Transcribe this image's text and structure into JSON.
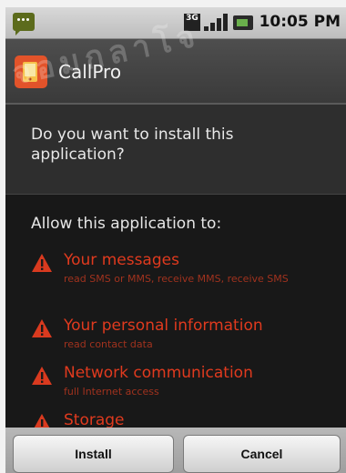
{
  "status_bar": {
    "network_type": "3G",
    "time": "10:05 PM",
    "icons": [
      "notification-icon",
      "3g-icon",
      "signal-icon",
      "battery-icon"
    ]
  },
  "dialog": {
    "app_name": "CallPro",
    "question": "Do you want to install this application?",
    "permissions_header": "Allow this application to:",
    "permissions": [
      {
        "title": "Your messages",
        "description": "read SMS or MMS, receive MMS, receive SMS"
      },
      {
        "title": "Your personal information",
        "description": "read contact data"
      },
      {
        "title": "Network communication",
        "description": "full Internet access"
      },
      {
        "title": "Storage",
        "description": ""
      }
    ]
  },
  "buttons": {
    "install": "Install",
    "cancel": "Cancel"
  },
  "watermark": "จอมกลาโจ",
  "colors": {
    "permission_title": "#e03a1e",
    "permission_desc": "#a0321e",
    "warning_icon": "#d93a1f",
    "app_icon": "#e2532a"
  }
}
